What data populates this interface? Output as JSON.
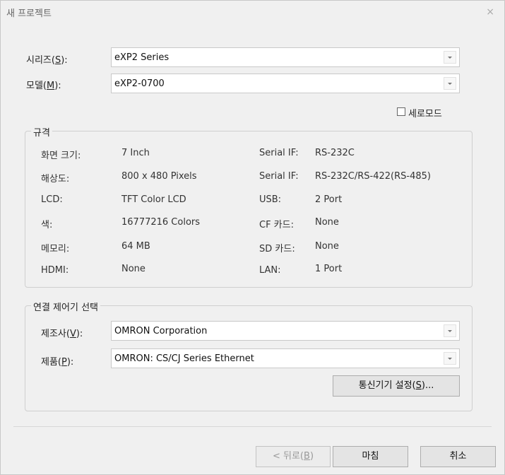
{
  "window": {
    "title": "새 프로젝트",
    "close_glyph": "×"
  },
  "series": {
    "label_pre": "시리즈(",
    "label_key": "S",
    "label_post": "):",
    "value": "eXP2 Series"
  },
  "model": {
    "label_pre": "모델(",
    "label_key": "M",
    "label_post": "):",
    "value": "eXP2-0700"
  },
  "portrait": {
    "label": "세로모드",
    "checked": false
  },
  "spec": {
    "title": "규격",
    "left": [
      {
        "label": "화면 크기:",
        "value": "7 Inch"
      },
      {
        "label": "해상도:",
        "value": "800 x 480 Pixels"
      },
      {
        "label": "LCD:",
        "value": "TFT Color LCD"
      },
      {
        "label": "색:",
        "value": "16777216 Colors"
      },
      {
        "label": "메모리:",
        "value": "64 MB"
      },
      {
        "label": "HDMI:",
        "value": "None"
      }
    ],
    "right": [
      {
        "label": "Serial IF:",
        "value": "RS-232C"
      },
      {
        "label": "Serial IF:",
        "value": "RS-232C/RS-422(RS-485)"
      },
      {
        "label": "USB:",
        "value": "2 Port"
      },
      {
        "label": "CF 카드:",
        "value": "None"
      },
      {
        "label": "SD 카드:",
        "value": "None"
      },
      {
        "label": "LAN:",
        "value": "1 Port"
      }
    ]
  },
  "controller": {
    "title": "연결 제어기 선택",
    "maker": {
      "label_pre": "제조사(",
      "label_key": "V",
      "label_post": "):",
      "value": "OMRON Corporation"
    },
    "product": {
      "label_pre": "제품(",
      "label_key": "P",
      "label_post": "):",
      "value": "OMRON: CS/CJ Series Ethernet"
    },
    "comm_button": {
      "pre": "통신기기 설정(",
      "key": "S",
      "post": ")..."
    }
  },
  "footer": {
    "back": {
      "pre": "< 뒤로(",
      "key": "B",
      "post": ")",
      "enabled": false
    },
    "finish": "마침",
    "cancel": "취소"
  }
}
